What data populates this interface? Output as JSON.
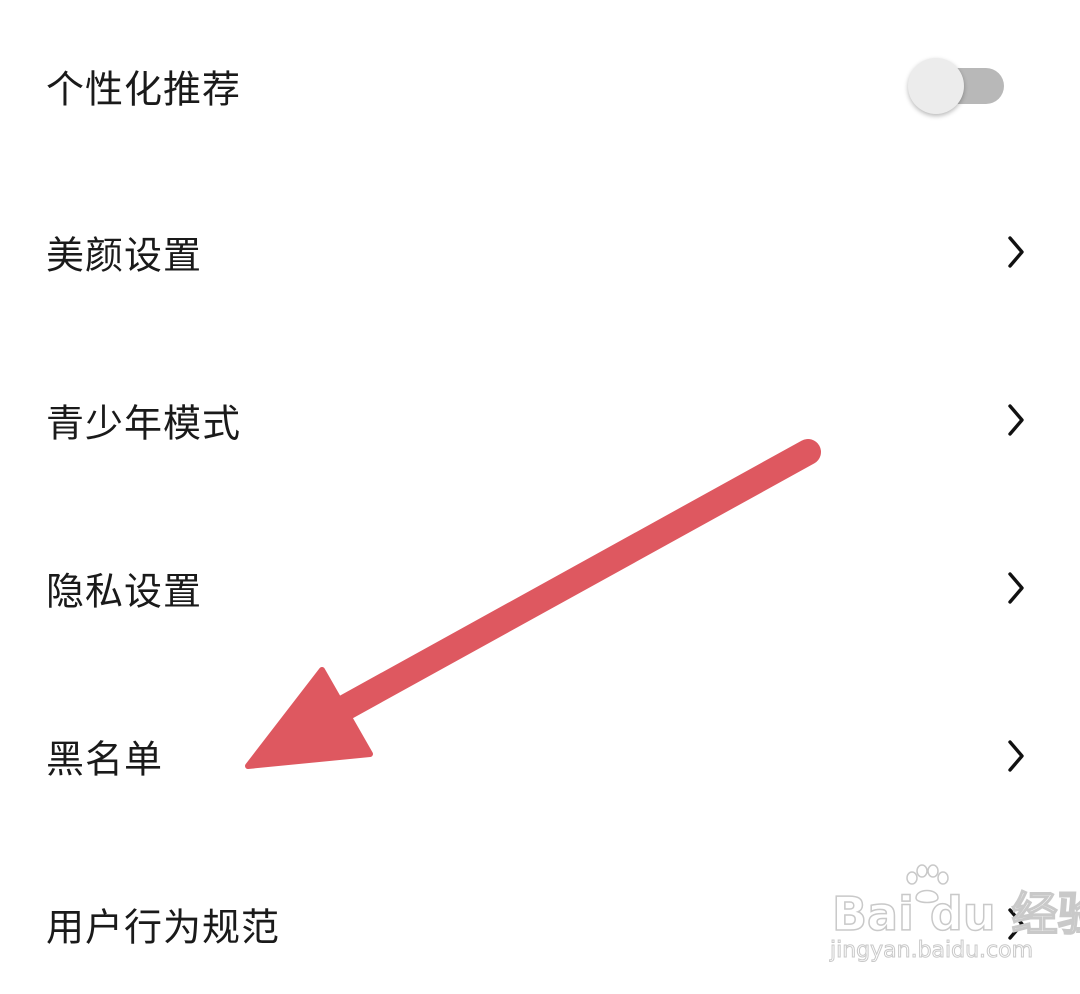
{
  "settings": {
    "items": [
      {
        "label": "个性化推荐",
        "control": "toggle",
        "toggle_on": false
      },
      {
        "label": "美颜设置",
        "control": "chevron"
      },
      {
        "label": "青少年模式",
        "control": "chevron"
      },
      {
        "label": "隐私设置",
        "control": "chevron"
      },
      {
        "label": "黑名单",
        "control": "chevron"
      },
      {
        "label": "用户行为规范",
        "control": "chevron"
      }
    ]
  },
  "annotation": {
    "arrow_color": "#de5860",
    "points_to": "黑名单"
  },
  "watermark": {
    "logo_text": "Bai du 经验",
    "url_text": "jingyan.baidu.com"
  },
  "colors": {
    "background": "#ffffff",
    "text": "#1a1a1a",
    "toggle_track_off": "#b8b8b8",
    "toggle_knob": "#ececec"
  },
  "icons": {
    "row_chevron": "chevron-right-icon",
    "toggle": "toggle-switch-off"
  }
}
